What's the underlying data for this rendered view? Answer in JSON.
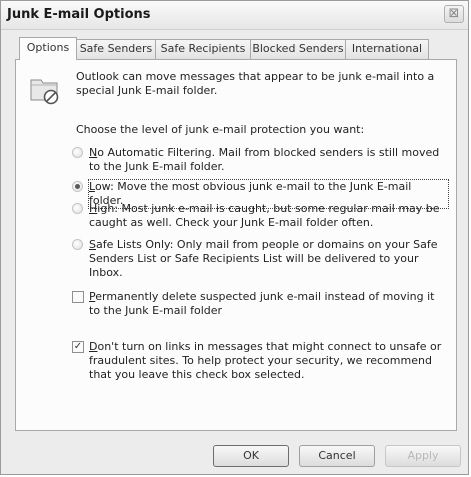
{
  "window": {
    "title": "Junk E-mail Options",
    "close_glyph": "⊠"
  },
  "tabs": [
    {
      "label": "Options",
      "active": true
    },
    {
      "label": "Safe Senders",
      "active": false
    },
    {
      "label": "Safe Recipients",
      "active": false
    },
    {
      "label": "Blocked Senders",
      "active": false
    },
    {
      "label": "International",
      "active": false
    }
  ],
  "intro": {
    "icon": "junk-folder-icon",
    "text": "Outlook can move messages that appear to be junk e-mail into a special Junk E-mail folder."
  },
  "protection_level": {
    "label": "Choose the level of junk e-mail protection you want:",
    "options": [
      {
        "accel": "N",
        "label": "o Automatic Filtering.  Mail from blocked senders is still moved to the Junk E-mail folder.",
        "selected": false
      },
      {
        "accel": "L",
        "label": "ow: Move the most obvious junk e-mail to the Junk E-mail folder.",
        "selected": true
      },
      {
        "accel": "H",
        "label": "igh: Most junk e-mail is caught, but some regular mail may be caught as well. Check your Junk E-mail folder often.",
        "selected": false
      },
      {
        "accel": "S",
        "label": "afe Lists Only: Only mail from people or domains on your Safe Senders List or Safe Recipients List will be delivered to your Inbox.",
        "selected": false
      }
    ]
  },
  "checkboxes": [
    {
      "accel": "P",
      "label": "ermanently delete suspected junk e-mail instead of moving it to the Junk E-mail folder",
      "checked": false,
      "check_glyph": ""
    },
    {
      "accel": "D",
      "label": "on't turn on links in messages that might connect to unsafe or fraudulent sites.  To help protect your security, we recommend that you leave this check box selected.",
      "checked": true,
      "check_glyph": "✓"
    }
  ],
  "buttons": {
    "ok": "OK",
    "cancel": "Cancel",
    "apply": "Apply"
  }
}
